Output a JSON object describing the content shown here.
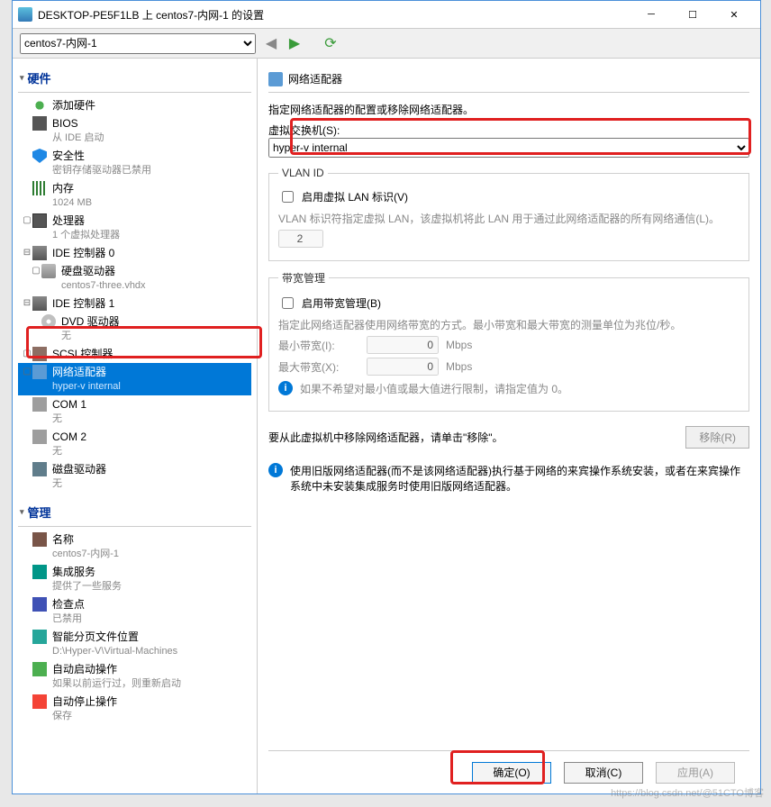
{
  "window": {
    "title": "DESKTOP-PE5F1LB 上 centos7-内网-1 的设置"
  },
  "toolbar": {
    "vm_selector": "centos7-内网-1"
  },
  "sidebar": {
    "hardware_header": "硬件",
    "management_header": "管理",
    "items": {
      "add_hardware": "添加硬件",
      "bios": {
        "label": "BIOS",
        "sub": "从 IDE 启动"
      },
      "security": {
        "label": "安全性",
        "sub": "密钥存储驱动器已禁用"
      },
      "memory": {
        "label": "内存",
        "sub": "1024 MB"
      },
      "cpu": {
        "label": "处理器",
        "sub": "1 个虚拟处理器"
      },
      "ide0": {
        "label": "IDE 控制器 0"
      },
      "hdd": {
        "label": "硬盘驱动器",
        "sub": "centos7-three.vhdx"
      },
      "ide1": {
        "label": "IDE 控制器 1"
      },
      "dvd": {
        "label": "DVD 驱动器",
        "sub": "无"
      },
      "scsi": {
        "label": "SCSI 控制器"
      },
      "net": {
        "label": "网络适配器",
        "sub": "hyper-v internal"
      },
      "com1": {
        "label": "COM 1",
        "sub": "无"
      },
      "com2": {
        "label": "COM 2",
        "sub": "无"
      },
      "floppy": {
        "label": "磁盘驱动器",
        "sub": "无"
      },
      "name": {
        "label": "名称",
        "sub": "centos7-内网-1"
      },
      "svc": {
        "label": "集成服务",
        "sub": "提供了一些服务"
      },
      "check": {
        "label": "检查点",
        "sub": "已禁用"
      },
      "page": {
        "label": "智能分页文件位置",
        "sub": "D:\\Hyper-V\\Virtual-Machines"
      },
      "autostart": {
        "label": "自动启动操作",
        "sub": "如果以前运行过，则重新启动"
      },
      "autostop": {
        "label": "自动停止操作",
        "sub": "保存"
      }
    }
  },
  "content": {
    "header": "网络适配器",
    "desc": "指定网络适配器的配置或移除网络适配器。",
    "vswitch_label": "虚拟交换机(S):",
    "vswitch_value": "hyper-v internal",
    "vlan": {
      "legend": "VLAN ID",
      "enable": "启用虚拟 LAN 标识(V)",
      "hint": "VLAN 标识符指定虚拟 LAN，该虚拟机将此 LAN 用于通过此网络适配器的所有网络通信(L)。",
      "value": "2"
    },
    "bandwidth": {
      "legend": "带宽管理",
      "enable": "启用带宽管理(B)",
      "hint": "指定此网络适配器使用网络带宽的方式。最小带宽和最大带宽的测量单位为兆位/秒。",
      "min_label": "最小带宽(I):",
      "max_label": "最大带宽(X):",
      "min_value": "0",
      "max_value": "0",
      "unit": "Mbps",
      "tip": "如果不希望对最小值或最大值进行限制，请指定值为 0。"
    },
    "remove_text": "要从此虚拟机中移除网络适配器，请单击\"移除\"。",
    "remove_btn": "移除(R)",
    "legacy_info": "使用旧版网络适配器(而不是该网络适配器)执行基于网络的来宾操作系统安装，或者在来宾操作系统中未安装集成服务时使用旧版网络适配器。"
  },
  "buttons": {
    "ok": "确定(O)",
    "cancel": "取消(C)",
    "apply": "应用(A)"
  },
  "watermark": "https://blog.csdn.net/@51CTO博客"
}
